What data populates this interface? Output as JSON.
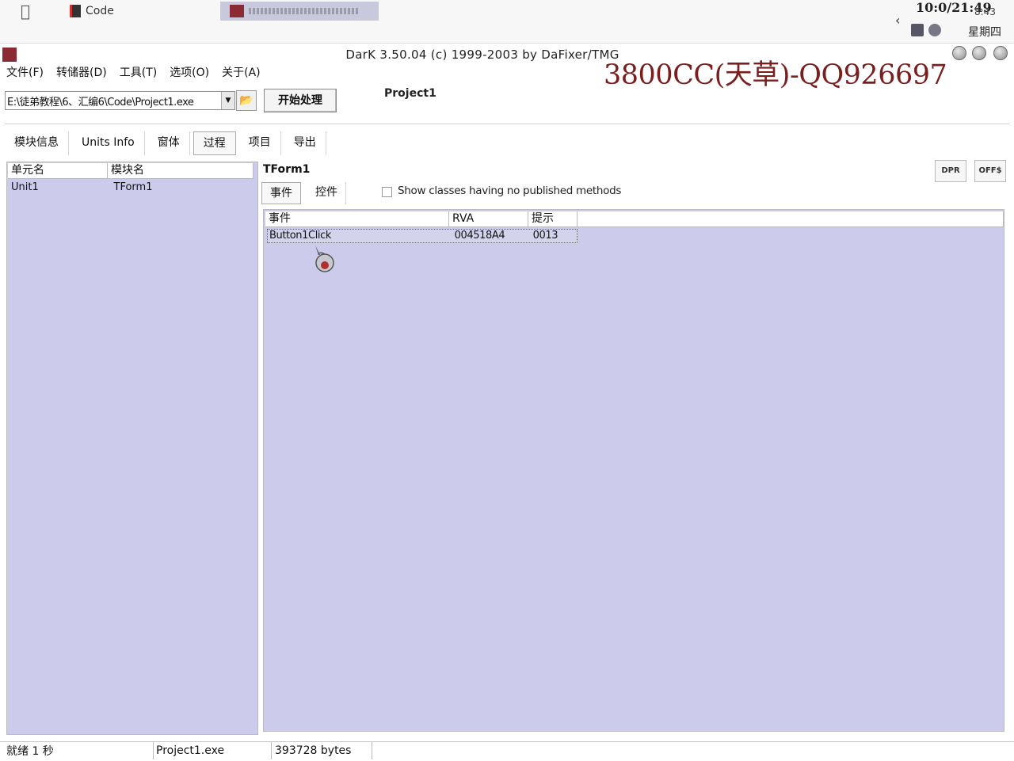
{
  "taskbar": {
    "task_label": "Code",
    "clock_time": "10:0/21:49",
    "clock_small": "8:43",
    "clock_day": "星期四"
  },
  "window": {
    "title": "DarK 3.50.04 (c) 1999-2003 by DaFixer/TMG",
    "watermark": "3800CC(天草)-QQ926697"
  },
  "menu": [
    "文件(F)",
    "转储器(D)",
    "工具(T)",
    "选项(O)",
    "关于(A)"
  ],
  "toolbar": {
    "path_value": "E:\\徒弟教程\\6、汇编6\\Code\\Project1.exe",
    "start_label": "开始处理",
    "project_label": "Project1"
  },
  "tabs": [
    "模块信息",
    "Units Info",
    "窗体",
    "过程",
    "项目",
    "导出"
  ],
  "active_tab": "过程",
  "units": {
    "headers": [
      "单元名",
      "模块名"
    ],
    "rows": [
      [
        "Unit1",
        "TForm1"
      ]
    ]
  },
  "form": {
    "name": "TForm1",
    "dpr_label": "DPR",
    "offs_label": "OFF$",
    "subtabs": [
      "事件",
      "控件"
    ],
    "checkbox_label": "Show classes having no published methods",
    "checkbox_checked": false
  },
  "events": {
    "headers": [
      "事件",
      "RVA",
      "提示"
    ],
    "rows": [
      [
        "Button1Click",
        "004518A4",
        "0013"
      ]
    ]
  },
  "status": {
    "ready": "就绪 1 秒",
    "file": "Project1.exe",
    "size": "393728 bytes"
  },
  "colors": {
    "panel_bg": "#cccbec",
    "watermark": "#7a1e1e"
  }
}
